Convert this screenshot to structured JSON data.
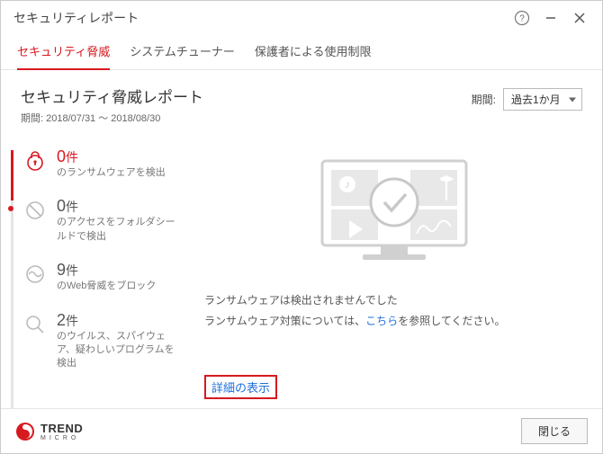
{
  "title": "セキュリティレポート",
  "tabs": {
    "threat": "セキュリティ脅威",
    "tuner": "システムチューナー",
    "parental": "保護者による使用制限"
  },
  "subhead": {
    "title": "セキュリティ脅威レポート",
    "period_label": "期間:",
    "period_value": "2018/07/31 ～ 2018/08/30",
    "dropdown_label": "期間:",
    "dropdown_value": "過去1か月"
  },
  "stats": {
    "s0": {
      "num": "0",
      "unit": "件",
      "desc": "のランサムウェアを検出"
    },
    "s1": {
      "num": "0",
      "unit": "件",
      "desc": "のアクセスをフォルダシールドで検出"
    },
    "s2": {
      "num": "9",
      "unit": "件",
      "desc": "のWeb脅威をブロック"
    },
    "s3": {
      "num": "2",
      "unit": "件",
      "desc": "のウイルス、スパイウェア、疑わしいプログラムを検出"
    }
  },
  "main": {
    "msg1": "ランサムウェアは検出されませんでした",
    "msg2_a": "ランサムウェア対策については、",
    "msg2_link": "こちら",
    "msg2_b": "を参照してください。",
    "detail_link": "詳細の表示"
  },
  "brand": {
    "name": "TREND",
    "sub": "MICRO"
  },
  "footer": {
    "close": "閉じる"
  }
}
